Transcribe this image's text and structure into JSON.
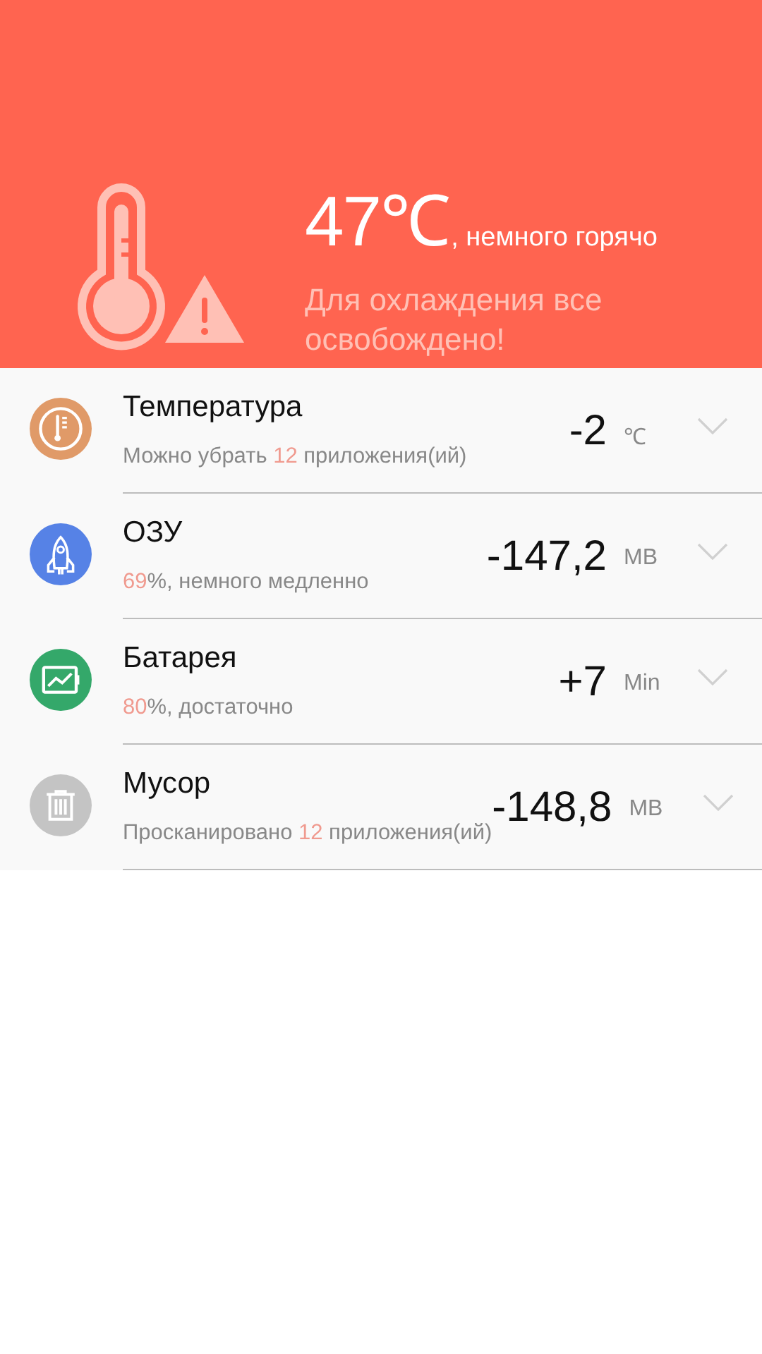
{
  "header": {
    "temperature": "47℃",
    "status": ", немного горячо",
    "message": "Для охлаждения все освобождено!"
  },
  "rows": [
    {
      "kind": "thermometer",
      "color": "#e09a68",
      "title": "Температура",
      "subtitle": [
        {
          "text": "Можно убрать ",
          "accent": false
        },
        {
          "text": "12",
          "accent": true
        },
        {
          "text": " приложения(ий)",
          "accent": false
        }
      ],
      "value": "-2",
      "unit": "℃"
    },
    {
      "kind": "rocket",
      "color": "#5682e6",
      "title": "ОЗУ",
      "subtitle": [
        {
          "text": "69",
          "accent": true
        },
        {
          "text": "%, немного медленно",
          "accent": false
        }
      ],
      "value": "-147,2",
      "unit": "MB"
    },
    {
      "kind": "battery",
      "color": "#34a86a",
      "title": "Батарея",
      "subtitle": [
        {
          "text": "80",
          "accent": true
        },
        {
          "text": "%, достаточно",
          "accent": false
        }
      ],
      "value": "+7",
      "unit": "Min"
    },
    {
      "kind": "trash",
      "color": "#c4c4c4",
      "title": "Мусор",
      "subtitle": [
        {
          "text": "Просканировано ",
          "accent": false
        },
        {
          "text": "12",
          "accent": true
        },
        {
          "text": " приложения(ий)",
          "accent": false
        }
      ],
      "value": "-148,8",
      "unit": "MB"
    }
  ]
}
